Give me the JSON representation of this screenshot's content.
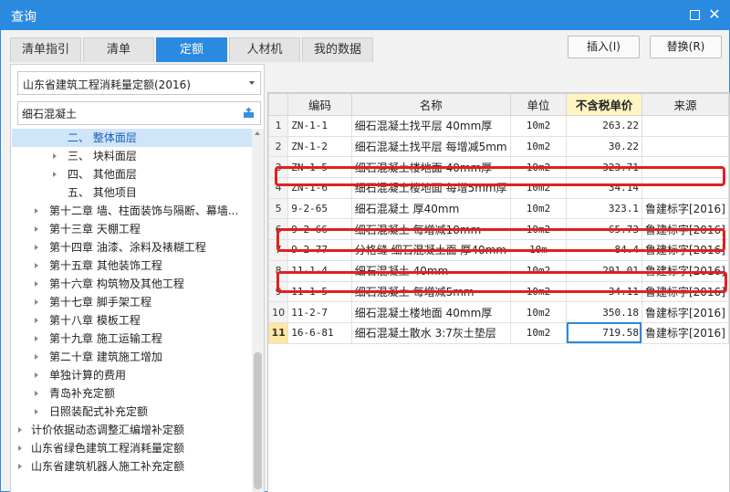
{
  "window": {
    "title": "查询"
  },
  "tabs": [
    {
      "label": "清单指引"
    },
    {
      "label": "清单"
    },
    {
      "label": "定额"
    },
    {
      "label": "人材机"
    },
    {
      "label": "我的数据"
    }
  ],
  "actions": {
    "insert": "插入(I)",
    "replace": "替换(R)"
  },
  "left": {
    "quota_library": "山东省建筑工程消耗量定额(2016)",
    "search_value": "细石混凝土",
    "tree": [
      {
        "label": "二、 整体面层",
        "selected": true
      },
      {
        "label": "三、 块料面层"
      },
      {
        "label": "四、 其他面层"
      },
      {
        "label": "五、 其他项目"
      },
      {
        "label": "第十二章 墙、柱面装饰与隔断、幕墙..."
      },
      {
        "label": "第十三章 天棚工程"
      },
      {
        "label": "第十四章 油漆、涂料及裱糊工程"
      },
      {
        "label": "第十五章 其他装饰工程"
      },
      {
        "label": "第十六章 构筑物及其他工程"
      },
      {
        "label": "第十七章 脚手架工程"
      },
      {
        "label": "第十八章 模板工程"
      },
      {
        "label": "第十九章 施工运输工程"
      },
      {
        "label": "第二十章 建筑施工增加"
      },
      {
        "label": "单独计算的费用"
      },
      {
        "label": "青岛补充定额"
      },
      {
        "label": "日照装配式补充定额"
      },
      {
        "label": "计价依据动态调整汇编增补定额"
      },
      {
        "label": "山东省绿色建筑工程消耗量定额"
      },
      {
        "label": "山东省建筑机器人施工补充定额"
      }
    ]
  },
  "grid": {
    "headers": {
      "code": "编码",
      "name": "名称",
      "unit": "单位",
      "price": "不含税单价",
      "source": "来源"
    },
    "rows": [
      {
        "no": "1",
        "code": "ZN-1-1",
        "name": "细石混凝土找平层 40mm厚",
        "unit": "10m2",
        "price": "263.22",
        "source": ""
      },
      {
        "no": "2",
        "code": "ZN-1-2",
        "name": "细石混凝土找平层 每增减5mm",
        "unit": "10m2",
        "price": "30.22",
        "source": ""
      },
      {
        "no": "3",
        "code": "ZN-1-5",
        "name": "细石混凝土楼地面 40mm厚",
        "unit": "10m2",
        "price": "323.71",
        "source": ""
      },
      {
        "no": "4",
        "code": "ZN-1-6",
        "name": "细石混凝土楼地面 每增5mm厚",
        "unit": "10m2",
        "price": "34.14",
        "source": ""
      },
      {
        "no": "5",
        "code": "9-2-65",
        "name": "细石混凝土 厚40mm",
        "unit": "10m2",
        "price": "323.1",
        "source": "鲁建标字[2016]"
      },
      {
        "no": "6",
        "code": "9-2-66",
        "name": "细石混凝土 每增减10mm",
        "unit": "10m2",
        "price": "65.73",
        "source": "鲁建标字[2016]"
      },
      {
        "no": "7",
        "code": "9-2-77",
        "name": "分格缝 细石混凝土面 厚40mm",
        "unit": "10m",
        "price": "84.4",
        "source": "鲁建标字[2016]"
      },
      {
        "no": "8",
        "code": "11-1-4",
        "name": "细石混凝土 40mm",
        "unit": "10m2",
        "price": "291.01",
        "source": "鲁建标字[2016]"
      },
      {
        "no": "9",
        "code": "11-1-5",
        "name": "细石混凝土 每增减5mm",
        "unit": "10m2",
        "price": "34.11",
        "source": "鲁建标字[2016]"
      },
      {
        "no": "10",
        "code": "11-2-7",
        "name": "细石混凝土楼地面 40mm厚",
        "unit": "10m2",
        "price": "350.18",
        "source": "鲁建标字[2016]"
      },
      {
        "no": "11",
        "code": "16-6-81",
        "name": "细石混凝土散水 3:7灰土垫层",
        "unit": "10m2",
        "price": "719.58",
        "source": "鲁建标字[2016]",
        "current": true
      }
    ]
  },
  "colors": {
    "accent": "#2a8ae0",
    "highlight_box": "#e02020",
    "selected_tree": "#cfe5fa",
    "price_header": "#fff4c2"
  }
}
